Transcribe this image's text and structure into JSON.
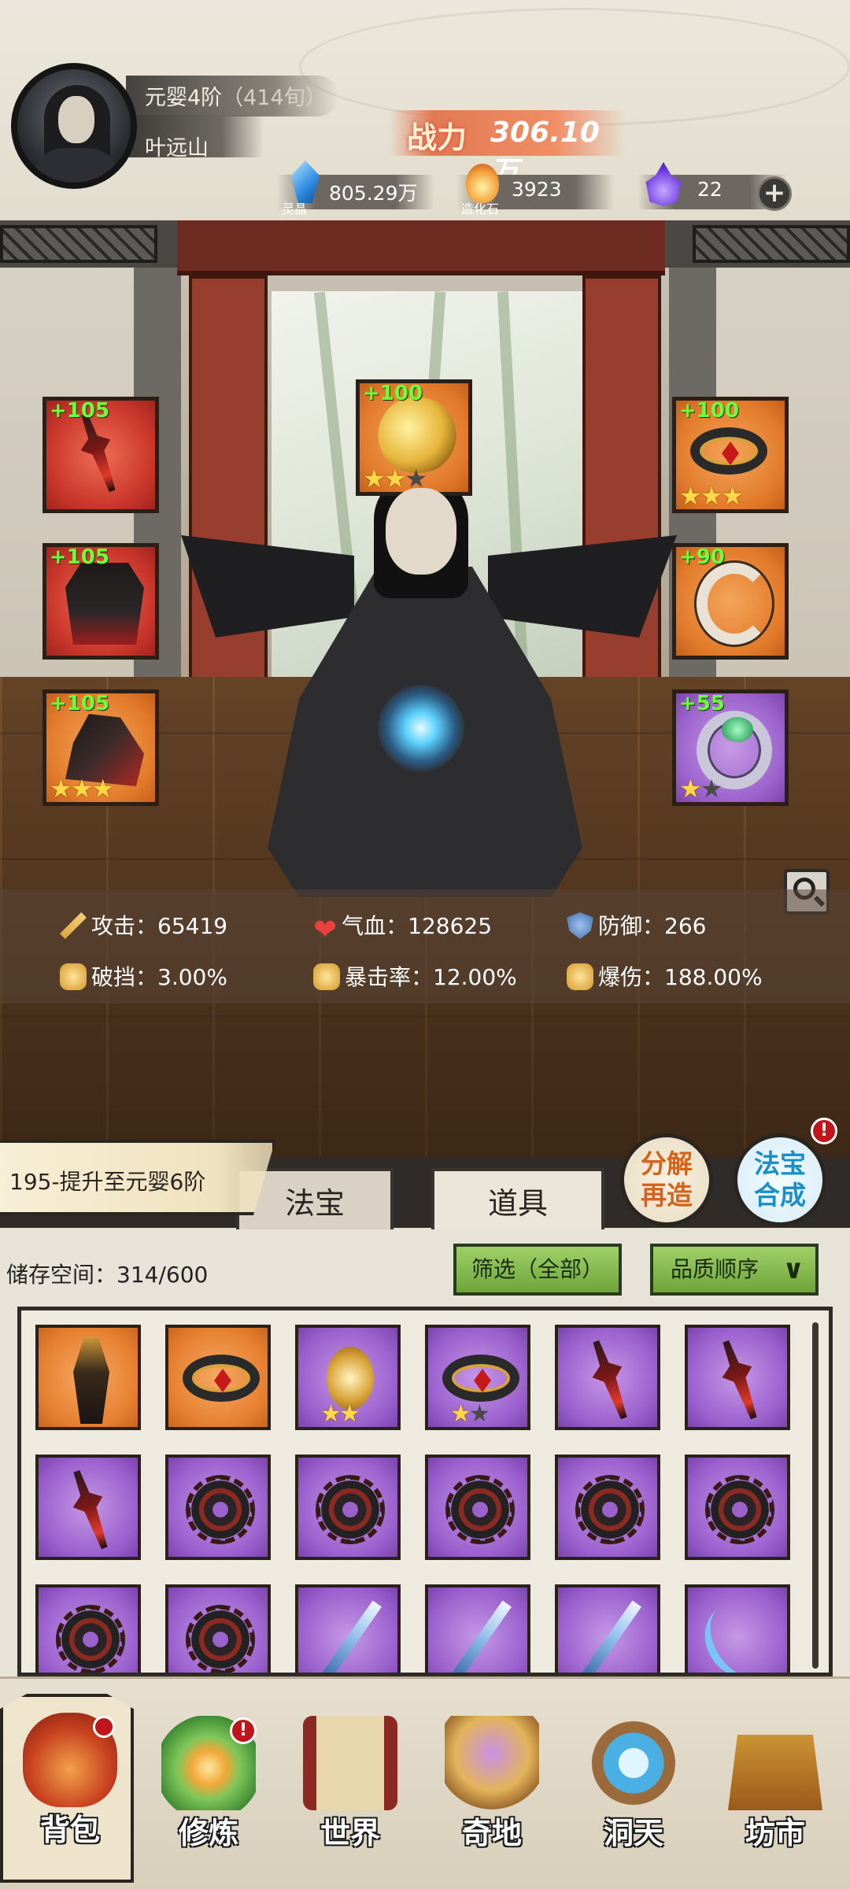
{
  "player": {
    "realm": "元婴4阶",
    "age": "（414旬）",
    "name": "叶远山",
    "power_label": "战力",
    "power_value": "306.10万"
  },
  "resources": [
    {
      "icon": "spirit-crystal-icon",
      "label": "灵晶",
      "value": "805.29万"
    },
    {
      "icon": "creation-stone-icon",
      "label": "造化石",
      "value": "3923"
    },
    {
      "icon": "purple-flame-icon",
      "label": "",
      "value": "22"
    }
  ],
  "equipment_slots": [
    {
      "position": "left-1",
      "level": "+105",
      "rarity": "red",
      "item": "dagger",
      "stars": 0
    },
    {
      "position": "left-2",
      "level": "+105",
      "rarity": "red",
      "item": "armor",
      "stars": 0
    },
    {
      "position": "left-3",
      "level": "+105",
      "rarity": "orange",
      "item": "boots",
      "stars": 3,
      "max_stars": 3
    },
    {
      "position": "top-center",
      "level": "+100",
      "rarity": "orange",
      "item": "golden-dragon",
      "stars": 2,
      "max_stars": 3
    },
    {
      "position": "right-1",
      "level": "+100",
      "rarity": "orange",
      "item": "crown-ring",
      "stars": 3,
      "max_stars": 3
    },
    {
      "position": "right-2",
      "level": "+90",
      "rarity": "orange",
      "item": "pendant",
      "stars": 0
    },
    {
      "position": "right-3",
      "level": "+55",
      "rarity": "purple",
      "item": "jade-ring",
      "stars": 1,
      "max_stars": 2
    }
  ],
  "stats": {
    "attack": "攻击：65419",
    "hp": "气血：128625",
    "defense": "防御：266",
    "penetration": "破挡：3.00%",
    "crit_rate": "暴击率：12.00%",
    "crit_damage": "爆伤：188.00%"
  },
  "quest": "195-提升至元婴6阶",
  "tabs": {
    "fabao": "法宝",
    "daoju": "道具"
  },
  "actions": {
    "decompose": "分解\n再造",
    "merge": "法宝\n合成",
    "merge_alert": "!"
  },
  "inventory": {
    "storage": "储存空间：314/600",
    "filter": "筛选（全部）",
    "sort": "品质顺序",
    "items": [
      {
        "rarity": "orange",
        "art": "totem",
        "stars": 0
      },
      {
        "rarity": "orange",
        "art": "ring",
        "stars": 0
      },
      {
        "rarity": "purple",
        "art": "amulet",
        "stars": 2,
        "max_stars": 2
      },
      {
        "rarity": "purple",
        "art": "ring",
        "stars": 1,
        "max_stars": 2
      },
      {
        "rarity": "purple",
        "art": "dagger",
        "stars": 0
      },
      {
        "rarity": "purple",
        "art": "dagger",
        "stars": 0
      },
      {
        "rarity": "purple",
        "art": "dagger",
        "stars": 0
      },
      {
        "rarity": "purple",
        "art": "saw",
        "stars": 0
      },
      {
        "rarity": "purple",
        "art": "saw",
        "stars": 0
      },
      {
        "rarity": "purple",
        "art": "saw",
        "stars": 0
      },
      {
        "rarity": "purple",
        "art": "saw",
        "stars": 0
      },
      {
        "rarity": "purple",
        "art": "saw",
        "stars": 0
      },
      {
        "rarity": "purple",
        "art": "saw",
        "stars": 0
      },
      {
        "rarity": "purple",
        "art": "saw",
        "stars": 0
      },
      {
        "rarity": "purple",
        "art": "blade",
        "stars": 0
      },
      {
        "rarity": "purple",
        "art": "blade",
        "stars": 0
      },
      {
        "rarity": "purple",
        "art": "blade",
        "stars": 0
      },
      {
        "rarity": "purple",
        "art": "bow",
        "stars": 0
      }
    ]
  },
  "nav": [
    {
      "label": "背包",
      "icon": "bag-icon"
    },
    {
      "label": "修炼",
      "icon": "lotus-icon",
      "alert": "!"
    },
    {
      "label": "世界",
      "icon": "scroll-icon"
    },
    {
      "label": "奇地",
      "icon": "land-icon"
    },
    {
      "label": "洞天",
      "icon": "portal-icon"
    },
    {
      "label": "坊市",
      "icon": "chest-icon"
    }
  ]
}
